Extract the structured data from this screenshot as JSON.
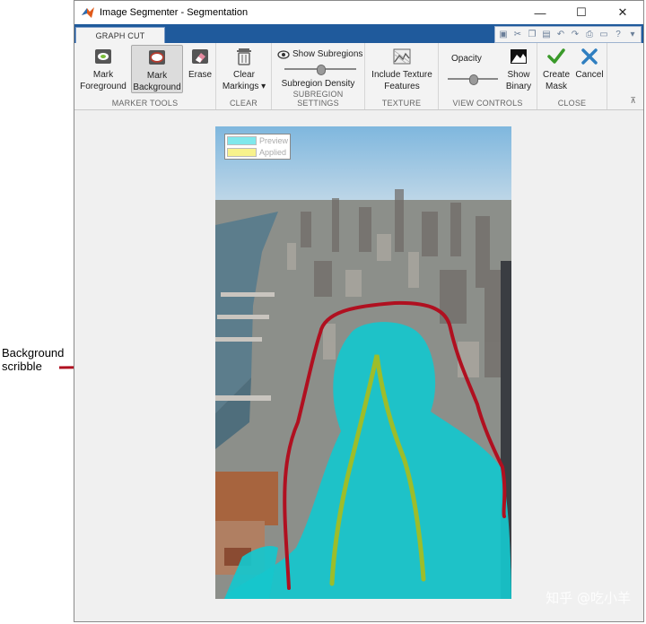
{
  "annotation": {
    "line1": "Background",
    "line2": "scribble",
    "arrow_color": "#b01020"
  },
  "window": {
    "title": "Image Segmenter - Segmentation",
    "min_glyph": "—",
    "max_glyph": "☐",
    "close_glyph": "✕"
  },
  "tabs": [
    {
      "label": "GRAPH CUT"
    }
  ],
  "ribbon": {
    "marker_tools": {
      "label": "MARKER TOOLS",
      "mark_fg": [
        "Mark",
        "Foreground"
      ],
      "mark_bg": [
        "Mark",
        "Background"
      ],
      "erase": "Erase"
    },
    "clear": {
      "label": "CLEAR",
      "clear_markings": [
        "Clear",
        "Markings ▾"
      ]
    },
    "subregion": {
      "label": "SUBREGION SETTINGS",
      "show_subregions": "Show Subregions",
      "density": "Subregion Density"
    },
    "texture": {
      "label": "TEXTURE",
      "include_texture": [
        "Include Texture",
        "Features"
      ]
    },
    "view": {
      "label": "VIEW CONTROLS",
      "opacity": "Opacity",
      "show_binary": [
        "Show",
        "Binary"
      ]
    },
    "close": {
      "label": "CLOSE",
      "create_mask": [
        "Create",
        "Mask"
      ],
      "cancel": "Cancel"
    }
  },
  "legend": {
    "preview": "Preview",
    "applied": "Applied",
    "preview_color": "#7fe8ec",
    "applied_color": "#f8f28c"
  },
  "watermark": "知乎 @吃小羊",
  "colors": {
    "foreground_scribble": "#9dbd2a",
    "background_scribble": "#b01020",
    "mask": "#16c6cc",
    "tab_bar": "#1f5a9c"
  }
}
